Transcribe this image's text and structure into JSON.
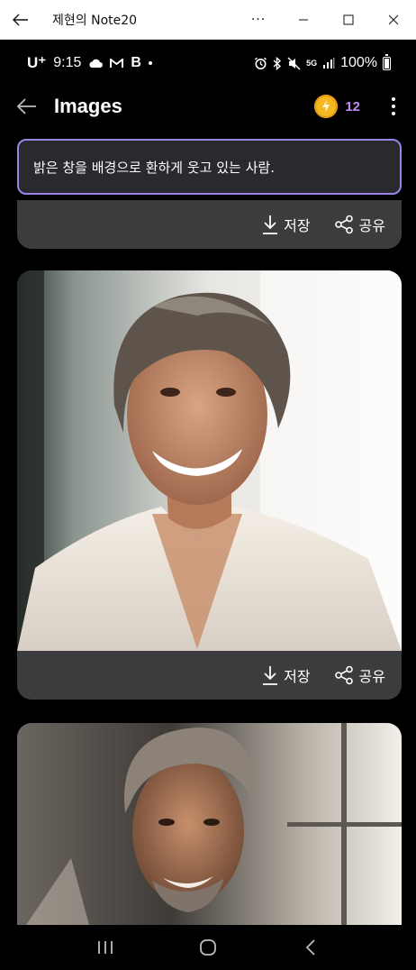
{
  "window": {
    "title": "제현의 Note20"
  },
  "status": {
    "carrier": "U⁺",
    "time": "9:15",
    "b_label": "B",
    "network": "5G",
    "battery": "100%"
  },
  "header": {
    "title": "Images",
    "credits": "12"
  },
  "prompt": {
    "text": "밝은 창을 배경으로 환하게 웃고 있는 사람."
  },
  "actions": {
    "save": "저장",
    "share": "공유"
  },
  "colors": {
    "accent": "#9b84e6",
    "credits": "#c58cf0",
    "card_bg": "#3c3c3f",
    "coin": "#f5b820"
  },
  "icons": [
    "back-arrow-icon",
    "more-icon",
    "minimize-icon",
    "maximize-icon",
    "close-icon",
    "cloud-icon",
    "gmail-icon",
    "alarm-icon",
    "bluetooth-icon",
    "mute-icon",
    "signal-icon",
    "battery-icon",
    "coin-icon",
    "kebab-icon",
    "download-icon",
    "share-icon",
    "recents-icon",
    "home-icon",
    "nav-back-icon"
  ]
}
